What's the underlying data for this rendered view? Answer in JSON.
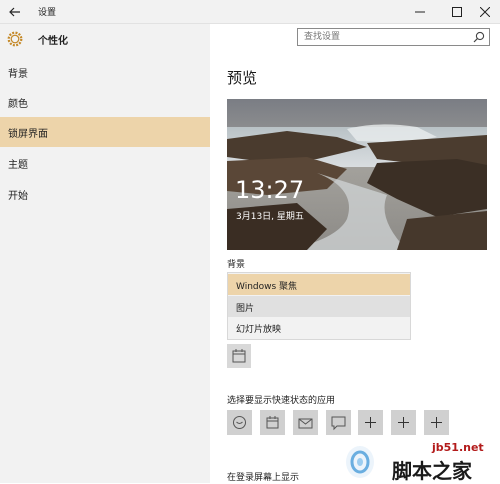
{
  "window": {
    "title": "设置",
    "controls": [
      "minimize-icon",
      "maximize-icon",
      "close-icon"
    ]
  },
  "sidebar": {
    "header": "个性化",
    "items": [
      {
        "label": "背景"
      },
      {
        "label": "颜色"
      },
      {
        "label": "锁屏界面"
      },
      {
        "label": "主题"
      },
      {
        "label": "开始"
      }
    ],
    "active_index": 2
  },
  "search": {
    "placeholder": "查找设置"
  },
  "main": {
    "title": "预览",
    "preview": {
      "time": "13:27",
      "date": "3月13日, 星期五"
    },
    "background_label": "背景",
    "dropdown_options": [
      "Windows 聚焦",
      "图片",
      "幻灯片放映"
    ],
    "quick_status_label": "选择要显示快速状态的应用",
    "app_slots": [
      "heart-icon",
      "calendar-icon",
      "mail-icon",
      "message-icon",
      "plus-icon",
      "plus-icon",
      "plus-icon"
    ],
    "bottom_label": "在登录屏幕上显示"
  },
  "watermark": {
    "site": "jb51.net",
    "name": "脚本之家"
  },
  "colors": {
    "accent": "#edd4aa",
    "sidebar_bg": "#f2f2f2"
  }
}
